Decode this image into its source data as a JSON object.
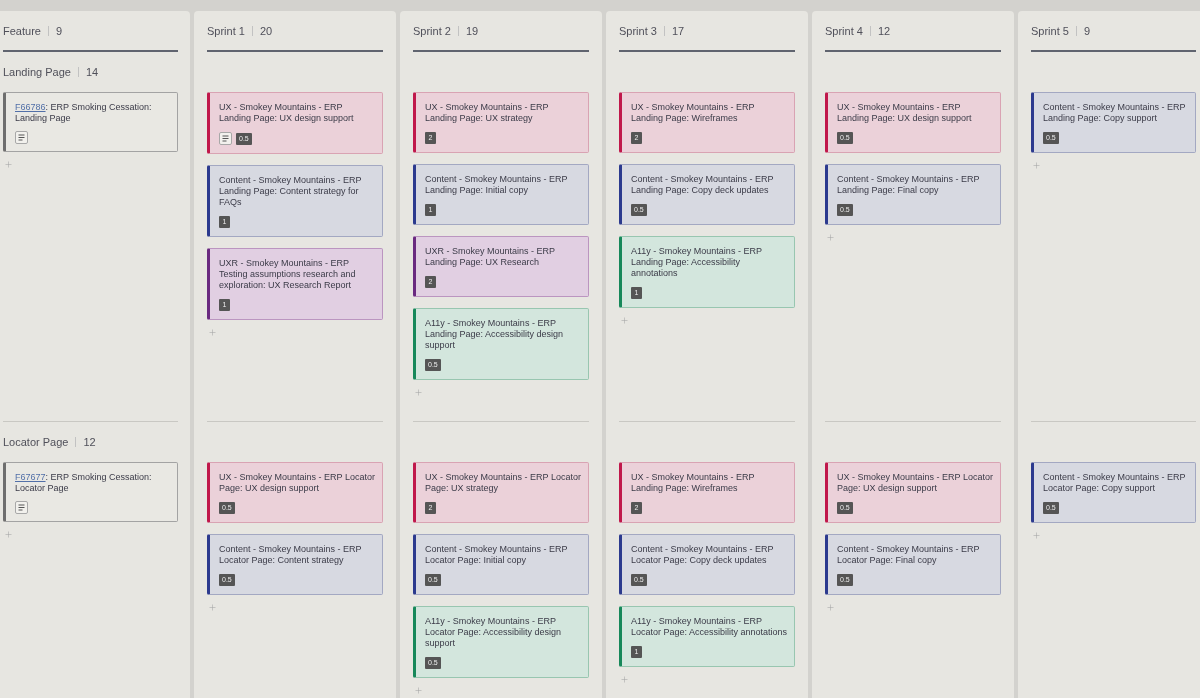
{
  "columns": [
    {
      "title": "Feature",
      "count": "9"
    },
    {
      "title": "Sprint 1",
      "count": "20"
    },
    {
      "title": "Sprint 2",
      "count": "19"
    },
    {
      "title": "Sprint 3",
      "count": "17"
    },
    {
      "title": "Sprint 4",
      "count": "12"
    },
    {
      "title": "Sprint 5",
      "count": "9"
    }
  ],
  "lanes": [
    {
      "title": "Landing Page",
      "count": "14",
      "feature": {
        "link": "F66786",
        "text": ": ERP Smoking Cessation: Landing Page",
        "has_notes": true
      },
      "sprints": [
        {
          "cards": [
            {
              "kind": "ux",
              "title": "UX - Smokey Mountains - ERP Landing Page: UX design support",
              "estimate": "0.5",
              "has_notes": true
            },
            {
              "kind": "content",
              "title": "Content - Smokey Mountains - ERP Landing Page: Content strategy for FAQs",
              "estimate": "1",
              "has_notes": false
            },
            {
              "kind": "research",
              "title": "UXR - Smokey Mountains - ERP Testing assumptions research and exploration: UX Research Report",
              "estimate": "1",
              "has_notes": false
            }
          ]
        },
        {
          "cards": [
            {
              "kind": "ux",
              "title": "UX - Smokey Mountains - ERP Landing Page: UX strategy",
              "estimate": "2",
              "has_notes": false
            },
            {
              "kind": "content",
              "title": "Content - Smokey Mountains - ERP Landing Page: Initial copy",
              "estimate": "1",
              "has_notes": false
            },
            {
              "kind": "research",
              "title": "UXR - Smokey Mountains - ERP Landing Page: UX Research",
              "estimate": "2",
              "has_notes": false
            },
            {
              "kind": "accessibility",
              "title": "A11y - Smokey Mountains - ERP Landing Page: Accessibility design support",
              "estimate": "0.5",
              "has_notes": false
            }
          ]
        },
        {
          "cards": [
            {
              "kind": "ux",
              "title": "UX - Smokey Mountains - ERP Landing Page: Wireframes",
              "estimate": "2",
              "has_notes": false
            },
            {
              "kind": "content",
              "title": "Content - Smokey Mountains - ERP Landing Page: Copy deck updates",
              "estimate": "0.5",
              "has_notes": false
            },
            {
              "kind": "accessibility",
              "title": "A11y - Smokey Mountains - ERP Landing Page: Accessibility annotations",
              "estimate": "1",
              "has_notes": false
            }
          ]
        },
        {
          "cards": [
            {
              "kind": "ux",
              "title": "UX - Smokey Mountains - ERP Landing Page: UX design support",
              "estimate": "0.5",
              "has_notes": false
            },
            {
              "kind": "content",
              "title": "Content - Smokey Mountains - ERP Landing Page: Final copy",
              "estimate": "0.5",
              "has_notes": false
            }
          ]
        },
        {
          "cards": [
            {
              "kind": "content",
              "title": "Content - Smokey Mountains - ERP Landing Page: Copy support",
              "estimate": "0.5",
              "has_notes": false
            }
          ]
        }
      ]
    },
    {
      "title": "Locator Page",
      "count": "12",
      "feature": {
        "link": "F67677",
        "text": ": ERP Smoking Cessation: Locator Page",
        "has_notes": true
      },
      "sprints": [
        {
          "cards": [
            {
              "kind": "ux",
              "title": "UX - Smokey Mountains - ERP Locator Page: UX design support",
              "estimate": "0.5",
              "has_notes": false
            },
            {
              "kind": "content",
              "title": "Content - Smokey Mountains - ERP Locator Page: Content strategy",
              "estimate": "0.5",
              "has_notes": false
            }
          ]
        },
        {
          "cards": [
            {
              "kind": "ux",
              "title": "UX - Smokey Mountains - ERP Locator Page: UX strategy",
              "estimate": "2",
              "has_notes": false
            },
            {
              "kind": "content",
              "title": "Content - Smokey Mountains - ERP Locator Page: Initial copy",
              "estimate": "0.5",
              "has_notes": false
            },
            {
              "kind": "accessibility",
              "title": "A11y - Smokey Mountains - ERP Locator Page: Accessibility design support",
              "estimate": "0.5",
              "has_notes": false
            }
          ]
        },
        {
          "cards": [
            {
              "kind": "ux",
              "title": "UX - Smokey Mountains - ERP Landing Page: Wireframes",
              "estimate": "2",
              "has_notes": false
            },
            {
              "kind": "content",
              "title": "Content - Smokey Mountains - ERP Locator Page: Copy deck updates",
              "estimate": "0.5",
              "has_notes": false
            },
            {
              "kind": "accessibility",
              "title": "A11y - Smokey Mountains - ERP Locator Page: Accessibility annotations",
              "estimate": "1",
              "has_notes": false
            }
          ]
        },
        {
          "cards": [
            {
              "kind": "ux",
              "title": "UX - Smokey Mountains - ERP Locator Page: UX design support",
              "estimate": "0.5",
              "has_notes": false
            },
            {
              "kind": "content",
              "title": "Content - Smokey Mountains - ERP Locator Page: Final copy",
              "estimate": "0.5",
              "has_notes": false
            }
          ]
        },
        {
          "cards": [
            {
              "kind": "content",
              "title": "Content - Smokey Mountains - ERP Locator Page: Copy support",
              "estimate": "0.5",
              "has_notes": false
            }
          ]
        }
      ]
    }
  ]
}
